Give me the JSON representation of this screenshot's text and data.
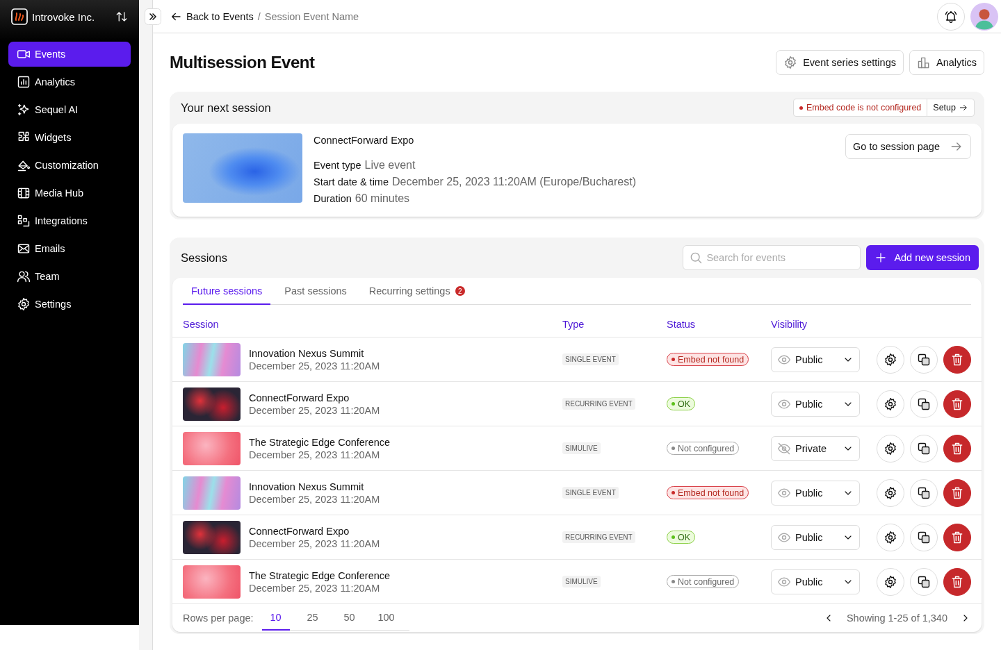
{
  "sidebar": {
    "org": "Introvoke Inc.",
    "items": [
      {
        "label": "Events",
        "selected": true
      },
      {
        "label": "Analytics",
        "selected": false
      },
      {
        "label": "Sequel AI",
        "selected": false
      },
      {
        "label": "Widgets",
        "selected": false
      },
      {
        "label": "Customization",
        "selected": false
      },
      {
        "label": "Media Hub",
        "selected": false
      },
      {
        "label": "Integrations",
        "selected": false
      },
      {
        "label": "Emails",
        "selected": false
      },
      {
        "label": "Team",
        "selected": false
      },
      {
        "label": "Settings",
        "selected": false
      }
    ]
  },
  "breadcrumb": {
    "back": "Back to Events",
    "separator": "/",
    "current": "Session Event Name"
  },
  "page": {
    "title": "Multisession Event",
    "actions": [
      "Event series settings",
      "Analytics"
    ]
  },
  "next_session": {
    "heading": "Your next session",
    "alert": "Embed code is not configured",
    "alert_action": "Setup",
    "name": "ConnectForward Expo",
    "button": "Go to session page",
    "details": [
      {
        "label": "Event type",
        "value": "Live event"
      },
      {
        "label": "Start date & time",
        "value": "December 25, 2023 11:20AM (Europe/Bucharest)"
      },
      {
        "label": "Duration",
        "value": "60 minutes"
      }
    ]
  },
  "sessions": {
    "heading": "Sessions",
    "search": {
      "placeholder": "Search for events"
    },
    "add_button": "Add new session",
    "tabs": [
      {
        "label": "Future sessions",
        "selected": true
      },
      {
        "label": "Past sessions",
        "selected": false
      },
      {
        "label": "Recurring settings",
        "selected": false,
        "badge": "2"
      }
    ],
    "table": {
      "columns": [
        "Session",
        "Type",
        "Status",
        "Visibility"
      ],
      "rows": [
        {
          "name": "Innovation Nexus Summit",
          "date": "December 25, 2023 11:20AM",
          "type": "SINGLE EVENT",
          "status": {
            "label": "Embed not found",
            "kind": "error"
          },
          "visibility": {
            "label": "Public",
            "hidden": false
          }
        },
        {
          "name": "ConnectForward Expo",
          "date": "December 25, 2023 11:20AM",
          "type": "RECURRING EVENT",
          "status": {
            "label": "OK",
            "kind": "ok"
          },
          "visibility": {
            "label": "Public",
            "hidden": false
          }
        },
        {
          "name": "The Strategic Edge Conference",
          "date": "December 25, 2023 11:20AM",
          "type": "SIMULIVE",
          "status": {
            "label": "Not configured",
            "kind": "neutral"
          },
          "visibility": {
            "label": "Private",
            "hidden": true
          }
        },
        {
          "name": "Innovation Nexus Summit",
          "date": "December 25, 2023 11:20AM",
          "type": "SINGLE EVENT",
          "status": {
            "label": "Embed not found",
            "kind": "error"
          },
          "visibility": {
            "label": "Public",
            "hidden": false
          }
        },
        {
          "name": "ConnectForward Expo",
          "date": "December 25, 2023 11:20AM",
          "type": "RECURRING EVENT",
          "status": {
            "label": "OK",
            "kind": "ok"
          },
          "visibility": {
            "label": "Public",
            "hidden": false
          }
        },
        {
          "name": "The Strategic Edge Conference",
          "date": "December 25, 2023 11:20AM",
          "type": "SIMULIVE",
          "status": {
            "label": "Not configured",
            "kind": "neutral"
          },
          "visibility": {
            "label": "Public",
            "hidden": false
          }
        }
      ]
    },
    "pagination": {
      "rows_label": "Rows per page:",
      "sizes": [
        {
          "label": "10",
          "selected": true
        },
        {
          "label": "25",
          "selected": false
        },
        {
          "label": "50",
          "selected": false
        },
        {
          "label": "100",
          "selected": false
        }
      ],
      "summary": "Showing 1-25 of 1,340"
    }
  }
}
